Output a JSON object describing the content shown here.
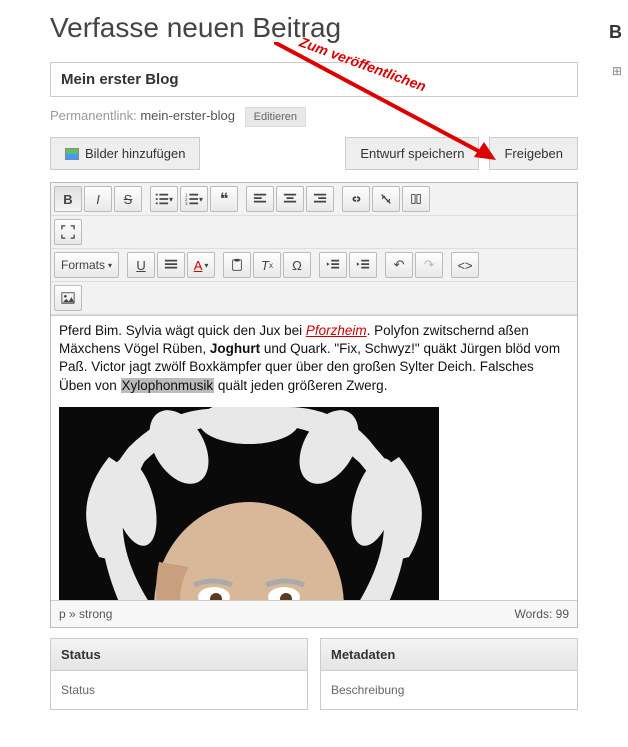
{
  "page_title": "Verfasse neuen Beitrag",
  "title_value": "Mein erster Blog",
  "permalink": {
    "label": "Permanentlink:",
    "slug": "mein-erster-blog",
    "edit": "Editieren"
  },
  "buttons": {
    "add_images": "Bilder hinzufügen",
    "save_draft": "Entwurf speichern",
    "publish": "Freigeben"
  },
  "annotation": "Zum veröffentlichen",
  "toolbar": {
    "formats": "Formats",
    "bold": "B",
    "italic": "I",
    "strike": "S",
    "ul": "≡",
    "ol": "≡",
    "quote": "❝",
    "align_l": "≡",
    "align_c": "≡",
    "align_r": "≡",
    "link": "🔗",
    "unlink": "✂",
    "anchor": "⎋",
    "fullscreen": "⛶",
    "underline": "U",
    "align_j": "≡",
    "color": "A",
    "paste": "📋",
    "clear": "Tx",
    "omega": "Ω",
    "indent": "→",
    "outdent": "←",
    "undo": "↶",
    "redo": "↷",
    "code": "<>",
    "image": "🖼"
  },
  "content": {
    "pre": "Pferd Bim. Sylvia wägt quick den Jux bei ",
    "link": "Pforzheim",
    "post1": ". Polyfon zwitschernd aßen Mäxchens Vögel Rüben, ",
    "bold": "Joghurt",
    "post2": " und Quark. \"Fix, Schwyz!\" quäkt Jürgen blöd vom Paß. Victor jagt zwölf Boxkämpfer quer über den großen Sylter Deich. Falsches Üben von ",
    "hl": "Xylophonmusik",
    "post3": " quält jeden größeren Zwerg."
  },
  "status": {
    "path": "p » strong",
    "words_label": "Words:",
    "words": "99"
  },
  "panels": {
    "left_h": "Status",
    "left_b": "Status",
    "right_h": "Metadaten",
    "right_b": "Beschreibung"
  },
  "corner": "B"
}
